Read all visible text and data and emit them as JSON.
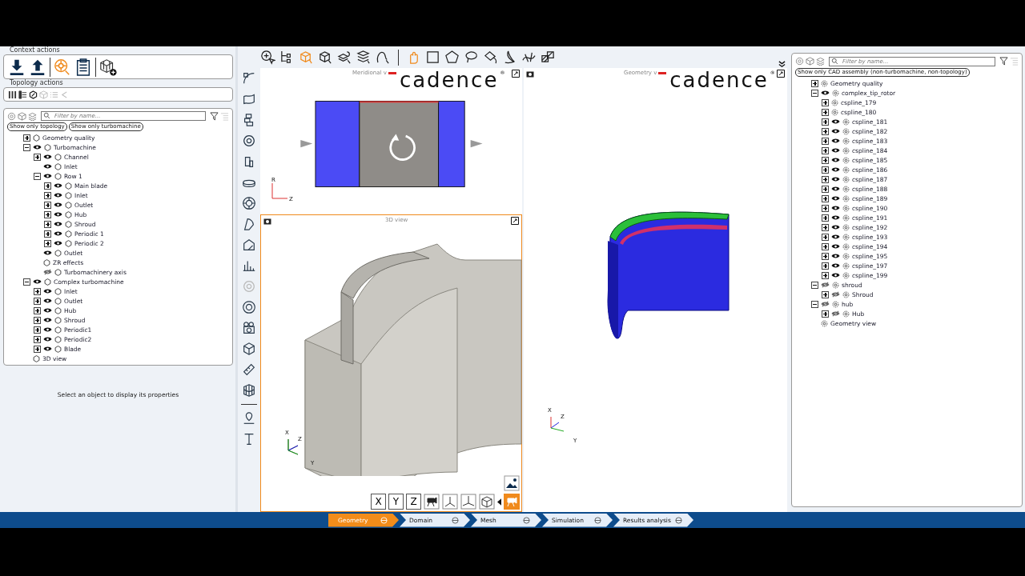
{
  "context_actions": {
    "title": "Context actions"
  },
  "topology_actions": {
    "title": "Topology actions"
  },
  "left_tree": {
    "filter": {
      "placeholder": "Filter by name..."
    },
    "filter_buttons": [
      "Show only topology",
      "Show only turbomachine"
    ],
    "items": [
      {
        "label": "Geometry quality",
        "expanded": false
      },
      {
        "label": "Turbomachine",
        "expanded": true,
        "visible": true,
        "children": [
          {
            "label": "Channel",
            "expanded": false,
            "visible": true
          },
          {
            "label": "Inlet",
            "visible": true
          },
          {
            "label": "Row 1",
            "expanded": true,
            "visible": true,
            "children": [
              {
                "label": "Main blade",
                "expanded": false,
                "visible": true
              },
              {
                "label": "Inlet",
                "expanded": false,
                "visible": true
              },
              {
                "label": "Outlet",
                "expanded": false,
                "visible": true
              },
              {
                "label": "Hub",
                "expanded": false,
                "visible": true
              },
              {
                "label": "Shroud",
                "expanded": false,
                "visible": true
              },
              {
                "label": "Periodic 1",
                "expanded": false,
                "visible": true
              },
              {
                "label": "Periodic 2",
                "expanded": false,
                "visible": true
              }
            ]
          },
          {
            "label": "Outlet",
            "visible": true
          },
          {
            "label": "ZR effects"
          },
          {
            "label": "Turbomachinery axis",
            "visible": false
          }
        ]
      },
      {
        "label": "Complex turbomachine",
        "expanded": true,
        "visible": true,
        "children": [
          {
            "label": "Inlet",
            "expanded": false,
            "visible": true
          },
          {
            "label": "Outlet",
            "expanded": false,
            "visible": true
          },
          {
            "label": "Hub",
            "expanded": false,
            "visible": true
          },
          {
            "label": "Shroud",
            "expanded": false,
            "visible": true
          },
          {
            "label": "Periodic1",
            "expanded": false,
            "visible": true
          },
          {
            "label": "Periodic2",
            "expanded": false,
            "visible": true
          },
          {
            "label": "Blade",
            "expanded": false,
            "visible": true
          }
        ]
      },
      {
        "label": "3D view"
      }
    ]
  },
  "properties": {
    "message": "Select an object to display its properties"
  },
  "meridional_view": {
    "title": "Meridional v",
    "logo": "cadence",
    "logo_mark": "®",
    "axes": [
      "R",
      "Z"
    ]
  },
  "view_3d": {
    "title": "3D view",
    "axes": [
      "X",
      "Z",
      "Y"
    ],
    "view_buttons": [
      "X",
      "Y",
      "Z"
    ]
  },
  "geometry_view": {
    "title": "Geometry v",
    "logo": "cadence",
    "logo_mark": "®",
    "axes": [
      "X",
      "Z",
      "Y"
    ]
  },
  "right_tree": {
    "filter": {
      "placeholder": "Filter by name..."
    },
    "filter_buttons": [
      "Show only CAD assembly (non-turbomachine, non-topology)"
    ],
    "items": [
      {
        "label": "Geometry quality",
        "expanded": false
      },
      {
        "label": "complex_tip_rotor",
        "expanded": true,
        "visible": true,
        "children": [
          {
            "label": "cspline_179",
            "expanded": false
          },
          {
            "label": "cspline_180",
            "expanded": false
          },
          {
            "label": "cspline_181",
            "expanded": false,
            "visible": true
          },
          {
            "label": "cspline_182",
            "expanded": false,
            "visible": true
          },
          {
            "label": "cspline_183",
            "expanded": false,
            "visible": true
          },
          {
            "label": "cspline_184",
            "expanded": false,
            "visible": true
          },
          {
            "label": "cspline_185",
            "expanded": false,
            "visible": true
          },
          {
            "label": "cspline_186",
            "expanded": false,
            "visible": true
          },
          {
            "label": "cspline_187",
            "expanded": false,
            "visible": true
          },
          {
            "label": "cspline_188",
            "expanded": false,
            "visible": true
          },
          {
            "label": "cspline_189",
            "expanded": false,
            "visible": true
          },
          {
            "label": "cspline_190",
            "expanded": false,
            "visible": true
          },
          {
            "label": "cspline_191",
            "expanded": false,
            "visible": true
          },
          {
            "label": "cspline_192",
            "expanded": false,
            "visible": true
          },
          {
            "label": "cspline_193",
            "expanded": false,
            "visible": true
          },
          {
            "label": "cspline_194",
            "expanded": false,
            "visible": true
          },
          {
            "label": "cspline_195",
            "expanded": false,
            "visible": true
          },
          {
            "label": "cspline_197",
            "expanded": false,
            "visible": true
          },
          {
            "label": "cspline_199",
            "expanded": false,
            "visible": true
          }
        ]
      },
      {
        "label": "shroud",
        "expanded": true,
        "visible": false,
        "children": [
          {
            "label": "Shroud",
            "expanded": false,
            "visible": false
          }
        ]
      },
      {
        "label": "hub",
        "expanded": true,
        "visible": false,
        "children": [
          {
            "label": "Hub",
            "expanded": false,
            "visible": false
          }
        ]
      },
      {
        "label": "Geometry view"
      }
    ]
  },
  "workflow": [
    {
      "label": "Geometry",
      "selected": true
    },
    {
      "label": "Domain",
      "selected": false
    },
    {
      "label": "Mesh",
      "selected": false
    },
    {
      "label": "Simulation",
      "selected": false
    },
    {
      "label": "Results analysis",
      "selected": false
    }
  ]
}
